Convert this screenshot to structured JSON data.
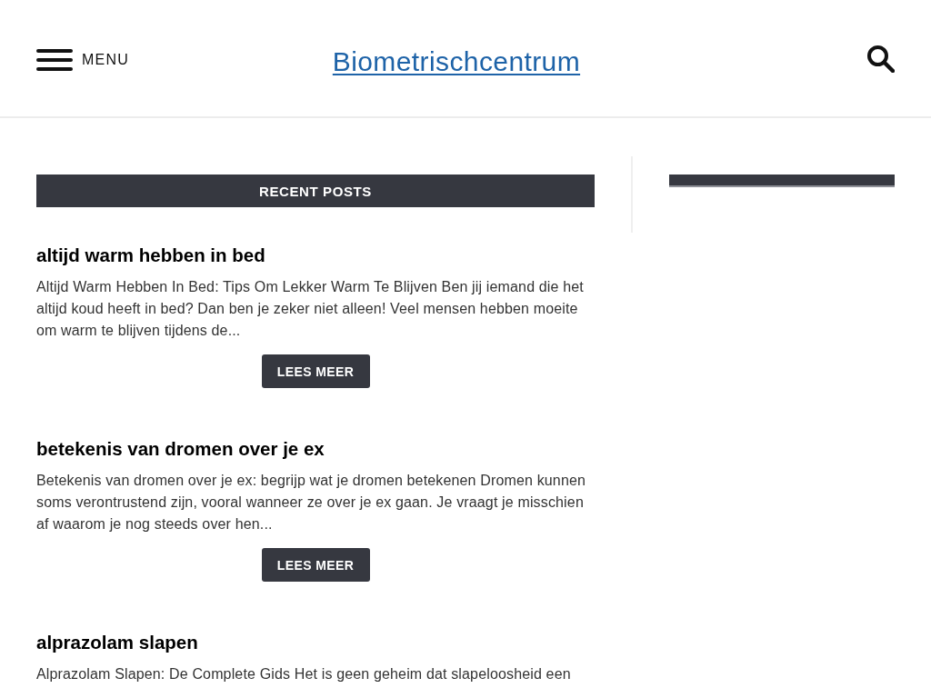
{
  "header": {
    "menu_label": "MENU",
    "site_title": "Biometrischcentrum"
  },
  "main": {
    "section_title": "RECENT POSTS",
    "posts": [
      {
        "title": "altijd warm hebben in bed",
        "excerpt": "Altijd Warm Hebben In Bed: Tips Om Lekker Warm Te Blijven Ben jij iemand die het altijd koud heeft in bed? Dan ben je zeker niet alleen! Veel mensen hebben moeite om warm te blijven tijdens de...",
        "button": "LEES MEER"
      },
      {
        "title": "betekenis van dromen over je ex",
        "excerpt": "Betekenis van dromen over je ex: begrijp wat je dromen betekenen Dromen kunnen soms verontrustend zijn, vooral wanneer ze over je ex gaan. Je vraagt je misschien af waarom je nog steeds over hen...",
        "button": "LEES MEER"
      },
      {
        "title": "alprazolam slapen",
        "excerpt": "Alprazolam Slapen: De Complete Gids Het is geen geheim dat slapeloosheid een"
      }
    ]
  }
}
